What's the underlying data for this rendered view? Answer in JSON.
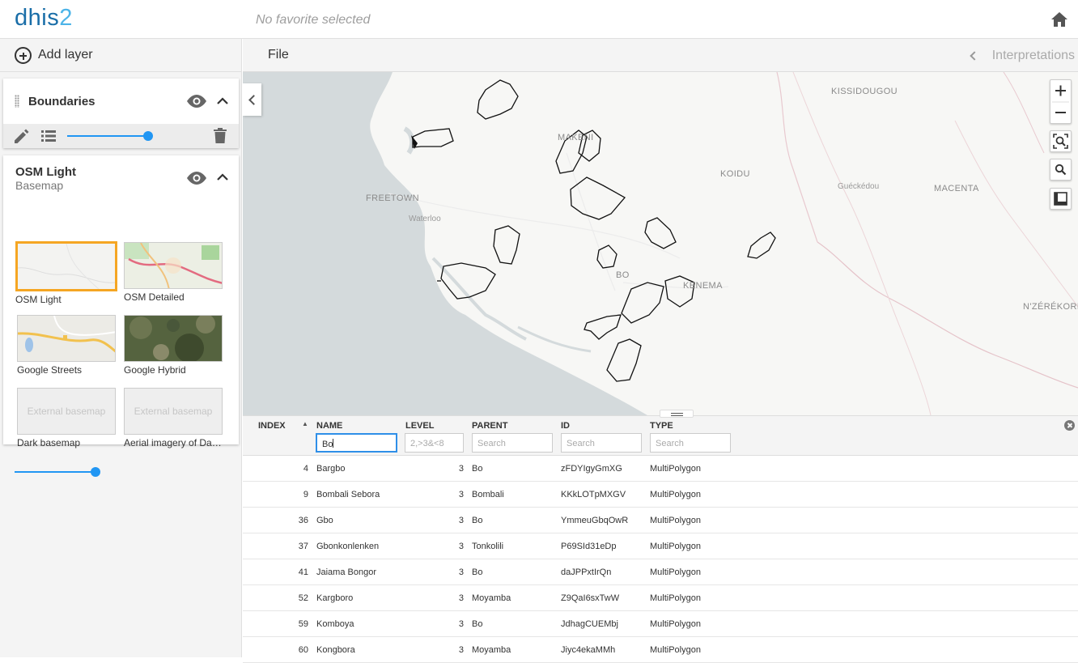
{
  "header": {
    "logo_main": "dhis",
    "logo_num": "2",
    "favorite": "No favorite selected"
  },
  "left_panel": {
    "add_layer": "Add layer",
    "layers": {
      "boundaries": {
        "title": "Boundaries",
        "opacity_percent": 100
      },
      "basemap": {
        "title": "OSM Light",
        "subtitle": "Basemap",
        "opacity_percent": 100,
        "options": [
          {
            "label": "OSM Light",
            "selected": true
          },
          {
            "label": "OSM Detailed",
            "selected": false
          },
          {
            "label": "Google Streets",
            "selected": false
          },
          {
            "label": "Google Hybrid",
            "selected": false
          },
          {
            "label": "Dark basemap",
            "placeholder": "External basemap",
            "selected": false
          },
          {
            "label": "Aerial imagery of Dar...",
            "placeholder": "External basemap",
            "selected": false
          }
        ]
      }
    }
  },
  "toolbar": {
    "file": "File",
    "interpretations": "Interpretations"
  },
  "map": {
    "labels": [
      "KISSIDOUGOU",
      "MAKENI",
      "KOIDU",
      "FREETOWN",
      "Guéckédou",
      "MACENTA",
      "Waterloo",
      "BO",
      "KENEMA",
      "N'ZÉRÉKORÉ"
    ]
  },
  "table": {
    "columns": [
      "INDEX",
      "NAME",
      "LEVEL",
      "PARENT",
      "ID",
      "TYPE"
    ],
    "filters": {
      "name": "Bo",
      "level_placeholder": "2,>3&<8",
      "parent_placeholder": "Search",
      "id_placeholder": "Search",
      "type_placeholder": "Search"
    },
    "rows": [
      {
        "index": "4",
        "name": "Bargbo",
        "level": "3",
        "parent": "Bo",
        "id": "zFDYIgyGmXG",
        "type": "MultiPolygon"
      },
      {
        "index": "9",
        "name": "Bombali Sebora",
        "level": "3",
        "parent": "Bombali",
        "id": "KKkLOTpMXGV",
        "type": "MultiPolygon"
      },
      {
        "index": "36",
        "name": "Gbo",
        "level": "3",
        "parent": "Bo",
        "id": "YmmeuGbqOwR",
        "type": "MultiPolygon"
      },
      {
        "index": "37",
        "name": "Gbonkonlenken",
        "level": "3",
        "parent": "Tonkolili",
        "id": "P69SId31eDp",
        "type": "MultiPolygon"
      },
      {
        "index": "41",
        "name": "Jaiama Bongor",
        "level": "3",
        "parent": "Bo",
        "id": "daJPPxtIrQn",
        "type": "MultiPolygon"
      },
      {
        "index": "52",
        "name": "Kargboro",
        "level": "3",
        "parent": "Moyamba",
        "id": "Z9QaI6sxTwW",
        "type": "MultiPolygon"
      },
      {
        "index": "59",
        "name": "Komboya",
        "level": "3",
        "parent": "Bo",
        "id": "JdhagCUEMbj",
        "type": "MultiPolygon"
      },
      {
        "index": "60",
        "name": "Kongbora",
        "level": "3",
        "parent": "Moyamba",
        "id": "Jiyc4ekaMMh",
        "type": "MultiPolygon"
      }
    ]
  },
  "colors": {
    "brand_blue": "#1a6ea8",
    "accent_blue": "#2196f3",
    "selected_border": "#f5a623"
  }
}
